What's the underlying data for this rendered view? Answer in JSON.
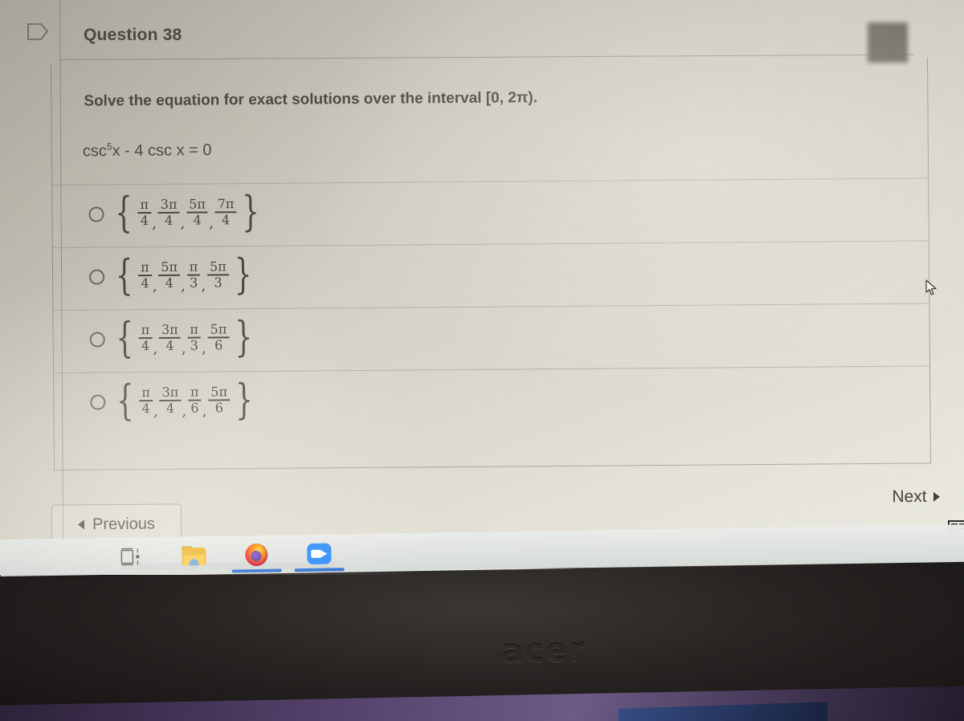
{
  "question": {
    "header_label": "Question 38",
    "prompt": "Solve the equation for exact solutions over the interval [0, 2π).",
    "equation_base": "csc",
    "equation_exponent": "5",
    "equation_rest": "x - 4 csc x = 0",
    "options": [
      {
        "id": "option-a",
        "selected": false,
        "fractions": [
          {
            "num": "π",
            "den": "4"
          },
          {
            "num": "3π",
            "den": "4"
          },
          {
            "num": "5π",
            "den": "4"
          },
          {
            "num": "7π",
            "den": "4"
          }
        ]
      },
      {
        "id": "option-b",
        "selected": false,
        "fractions": [
          {
            "num": "π",
            "den": "4"
          },
          {
            "num": "5π",
            "den": "4"
          },
          {
            "num": "π",
            "den": "3"
          },
          {
            "num": "5π",
            "den": "3"
          }
        ]
      },
      {
        "id": "option-c",
        "selected": false,
        "fractions": [
          {
            "num": "π",
            "den": "4"
          },
          {
            "num": "3π",
            "den": "4"
          },
          {
            "num": "π",
            "den": "3"
          },
          {
            "num": "5π",
            "den": "6"
          }
        ]
      },
      {
        "id": "option-d",
        "selected": false,
        "fractions": [
          {
            "num": "π",
            "den": "4"
          },
          {
            "num": "3π",
            "den": "4"
          },
          {
            "num": "π",
            "den": "6"
          },
          {
            "num": "5π",
            "den": "6"
          }
        ]
      }
    ]
  },
  "navigation": {
    "previous_label": "Previous",
    "next_label": "Next"
  },
  "icons": {
    "left_margin_tag": "tag-icon",
    "panel_list": "list-panel-icon",
    "cursor": "mouse-cursor"
  },
  "taskbar": {
    "items": [
      {
        "name": "task-view",
        "label": "Task View",
        "active": false
      },
      {
        "name": "file-explorer",
        "label": "File Explorer",
        "active": false
      },
      {
        "name": "firefox",
        "label": "Firefox",
        "active": true
      },
      {
        "name": "zoom",
        "label": "Zoom",
        "active": true
      }
    ]
  },
  "hardware": {
    "brand_logo": "acer"
  },
  "colors": {
    "screen_paper": "#d8d5cb",
    "text_dark": "#4a4843",
    "taskbar_active": "#2b6fd4",
    "firefox_orange": "#ff7139",
    "zoom_blue": "#2d8cff",
    "folder_yellow": "#f0b429",
    "bezel_black": "#1d1b19",
    "desk_purple": "#53426b"
  }
}
